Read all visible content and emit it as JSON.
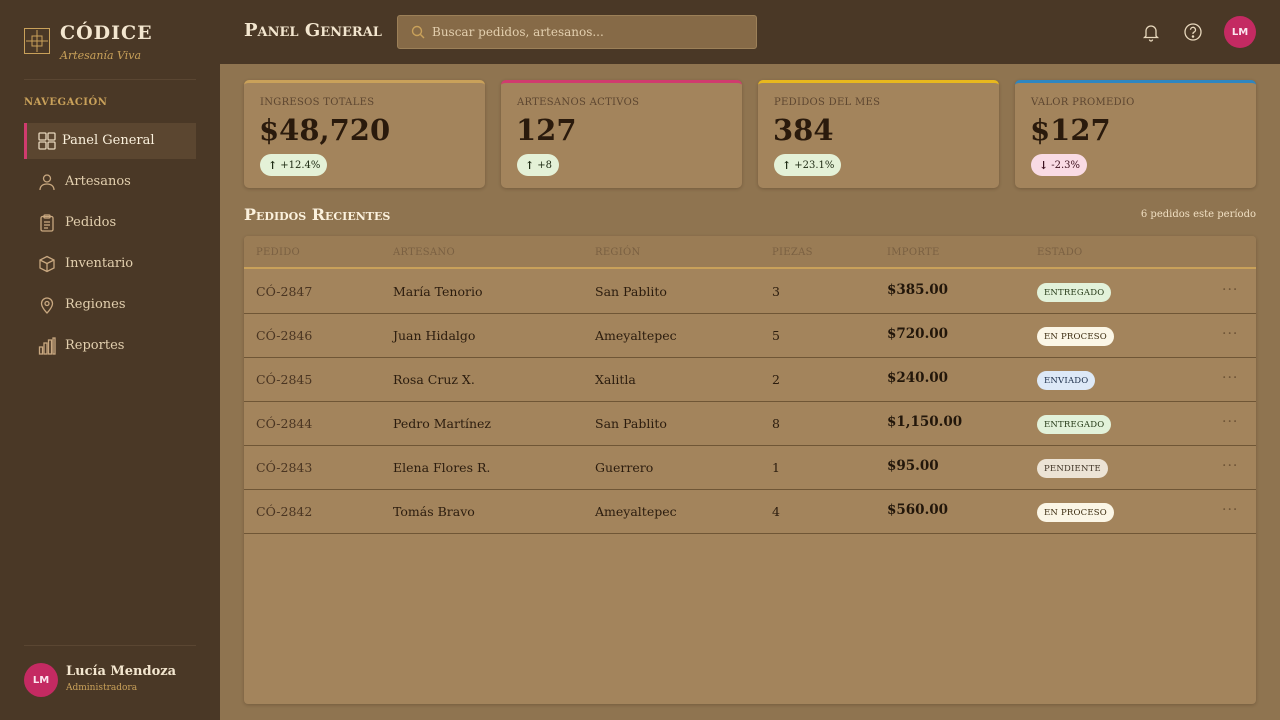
{
  "brand": {
    "name": "CÓDICE",
    "tagline": "Artesanía Viva"
  },
  "nav": {
    "title": "NAVEGACIÓN",
    "items": [
      {
        "label": "Panel General",
        "icon": "grid-icon",
        "active": true
      },
      {
        "label": "Artesanos",
        "icon": "user-icon"
      },
      {
        "label": "Pedidos",
        "icon": "clipboard-icon"
      },
      {
        "label": "Inventario",
        "icon": "box-icon"
      },
      {
        "label": "Regiones",
        "icon": "map-pin-icon"
      },
      {
        "label": "Reportes",
        "icon": "bar-chart-icon"
      }
    ]
  },
  "user": {
    "initials": "LM",
    "name": "Lucía Mendoza",
    "role": "Administradora"
  },
  "header": {
    "title": "Panel General",
    "search_placeholder": "Buscar pedidos, artesanos..."
  },
  "stats": [
    {
      "label": "INGRESOS TOTALES",
      "value": "$48,720",
      "delta": "+12.4%",
      "trend": "up",
      "accent": "#c9a15a"
    },
    {
      "label": "ARTESANOS ACTIVOS",
      "value": "127",
      "delta": "+8",
      "trend": "up",
      "accent": "#d03b6e"
    },
    {
      "label": "PEDIDOS DEL MES",
      "value": "384",
      "delta": "+23.1%",
      "trend": "up",
      "accent": "#e8b81e"
    },
    {
      "label": "VALOR PROMEDIO",
      "value": "$127",
      "delta": "-2.3%",
      "trend": "down",
      "accent": "#2e86c1"
    }
  ],
  "orders": {
    "title": "Pedidos Recientes",
    "meta": "6 pedidos este período",
    "columns": [
      "PEDIDO",
      "ARTESANO",
      "REGIÓN",
      "PIEZAS",
      "IMPORTE",
      "ESTADO"
    ],
    "rows": [
      {
        "id": "CÓ-2847",
        "artisan": "María Tenorio",
        "region": "San Pablito",
        "pieces": "3",
        "amount": "$385.00",
        "status": "ENTREGADO",
        "status_key": "entregado"
      },
      {
        "id": "CÓ-2846",
        "artisan": "Juan Hidalgo",
        "region": "Ameyaltepec",
        "pieces": "5",
        "amount": "$720.00",
        "status": "EN PROCESO",
        "status_key": "proceso"
      },
      {
        "id": "CÓ-2845",
        "artisan": "Rosa Cruz X.",
        "region": "Xalitla",
        "pieces": "2",
        "amount": "$240.00",
        "status": "ENVIADO",
        "status_key": "enviado"
      },
      {
        "id": "CÓ-2844",
        "artisan": "Pedro Martínez",
        "region": "San Pablito",
        "pieces": "8",
        "amount": "$1,150.00",
        "status": "ENTREGADO",
        "status_key": "entregado"
      },
      {
        "id": "CÓ-2843",
        "artisan": "Elena Flores R.",
        "region": "Guerrero",
        "pieces": "1",
        "amount": "$95.00",
        "status": "PENDIENTE",
        "status_key": "pendiente"
      },
      {
        "id": "CÓ-2842",
        "artisan": "Tomás Bravo",
        "region": "Ameyaltepec",
        "pieces": "4",
        "amount": "$560.00",
        "status": "EN PROCESO",
        "status_key": "proceso"
      }
    ]
  }
}
